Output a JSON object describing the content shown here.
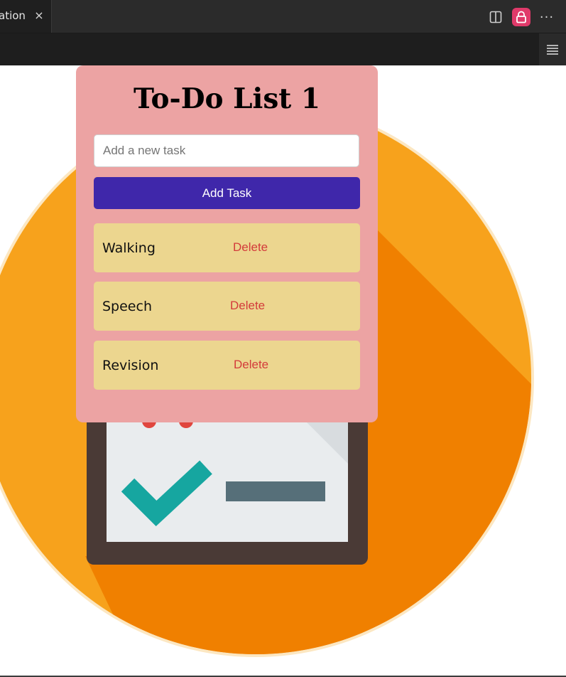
{
  "editor": {
    "tab_label": "ation",
    "tab_close": "×",
    "icons": [
      "split-editor-icon",
      "lock-icon",
      "more-actions-icon",
      "menu-icon"
    ],
    "colors": {
      "lock_button": "#e03a6a",
      "tabbar": "#2b2b2b"
    }
  },
  "app": {
    "title": "To-Do List 1",
    "input_placeholder": "Add a new task",
    "input_value": "",
    "add_button_label": "Add Task",
    "tasks": [
      {
        "text": "Walking",
        "delete_label": "Delete"
      },
      {
        "text": "Speech",
        "delete_label": "Delete"
      },
      {
        "text": "Revision",
        "delete_label": "Delete"
      }
    ],
    "colors": {
      "card_bg": "#eca3a3",
      "button_bg": "#3f27aa",
      "task_bg": "#ecd68f",
      "delete_text": "#d33b3b"
    }
  },
  "background": {
    "icon": "clipboard-checklist-illustration",
    "colors": {
      "circle": "#f7a21c",
      "shadow": "#f08000"
    }
  }
}
